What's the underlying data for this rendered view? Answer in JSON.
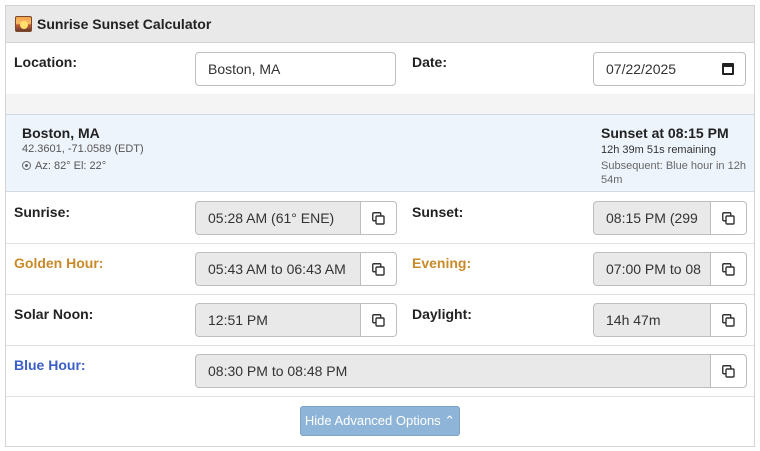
{
  "header": {
    "title": "Sunrise Sunset Calculator",
    "icon": "sunset-icon"
  },
  "form": {
    "location_label": "Location:",
    "location_value": "Boston, MA",
    "date_label": "Date:",
    "date_value": "07/22/2025"
  },
  "info": {
    "city": "Boston, MA",
    "coords": "42.3601, -71.0589 (EDT)",
    "azel": "Az: 82° El: 22°",
    "sunset_title": "Sunset at 08:15 PM",
    "remaining": "12h 39m 51s remaining",
    "subsequent": "Subsequent: Blue hour in 12h 54m"
  },
  "rows": {
    "sunrise_label": "Sunrise:",
    "sunrise_value": "05:28 AM (61° ENE)",
    "sunset_label": "Sunset:",
    "sunset_value": "08:15 PM (299",
    "golden_label": "Golden Hour:",
    "golden_value": "05:43 AM to 06:43 AM",
    "evening_label": "Evening:",
    "evening_value": "07:00 PM to 08",
    "noon_label": "Solar Noon:",
    "noon_value": "12:51 PM",
    "daylight_label": "Daylight:",
    "daylight_value": "14h 47m",
    "blue_label": "Blue Hour:",
    "blue_value": "08:30 PM to 08:48 PM"
  },
  "advanced_button": "Hide Advanced Options ⌃",
  "colors": {
    "golden": "#c98a2a",
    "blue": "#3a5fc8",
    "button": "#8eb5d8",
    "info_bg": "#eef4fc"
  }
}
